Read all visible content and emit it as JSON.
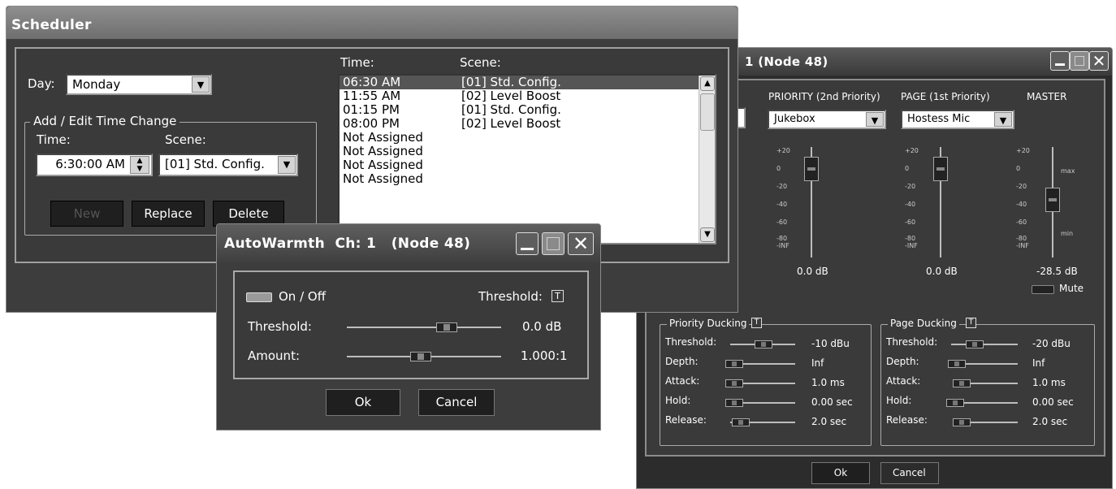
{
  "scheduler": {
    "title": "Scheduler",
    "day_label": "Day:",
    "day_value": "Monday",
    "group_label": "Add / Edit Time Change",
    "time_label": "Time:",
    "scene_label": "Scene:",
    "time_value": "6:30:00 AM",
    "scene_value": "[01] Std. Config.",
    "new_label": "New",
    "replace_label": "Replace",
    "delete_label": "Delete",
    "list_time_header": "Time:",
    "list_scene_header": "Scene:",
    "list": [
      {
        "time": "06:30 AM",
        "scene": "[01] Std. Config."
      },
      {
        "time": "11:55 AM",
        "scene": "[02] Level Boost"
      },
      {
        "time": "01:15 PM",
        "scene": "[01] Std. Config."
      },
      {
        "time": "08:00 PM",
        "scene": "[02] Level Boost"
      },
      {
        "time": "Not Assigned",
        "scene": ""
      },
      {
        "time": "Not Assigned",
        "scene": ""
      },
      {
        "time": "Not Assigned",
        "scene": ""
      },
      {
        "time": "Not Assigned",
        "scene": ""
      }
    ]
  },
  "autowarmth": {
    "title": "AutoWarmth  Ch: 1   (Node 48)",
    "on_off_label": "On / Off",
    "threshold_t_label": "Threshold:",
    "t_icon": "T",
    "threshold_label": "Threshold:",
    "threshold_value": "0.0 dB",
    "amount_label": "Amount:",
    "amount_value": "1.000:1",
    "ok_label": "Ok",
    "cancel_label": "Cancel"
  },
  "ducker": {
    "title": "1   (Node 48)",
    "priority_header": "PRIORITY (2nd Priority)",
    "priority_value": "Jukebox",
    "page_header": "PAGE (1st Priority)",
    "page_value": "Hostess Mic",
    "master_header": "MASTER",
    "fader_ticks": [
      "+20",
      "0",
      "-20",
      "-40",
      "-60",
      "-80",
      "-INF"
    ],
    "master_max": "max",
    "master_min": "min",
    "priority_db": "0.0 dB",
    "page_db": "0.0 dB",
    "master_db": "-28.5 dB",
    "mute_label": "Mute",
    "priority_ducking": {
      "label": "Priority Ducking",
      "t_icon": "T",
      "params": [
        {
          "name": "Threshold:",
          "value": "-10 dBu"
        },
        {
          "name": "Depth:",
          "value": "Inf"
        },
        {
          "name": "Attack:",
          "value": "1.0 ms"
        },
        {
          "name": "Hold:",
          "value": "0.00 sec"
        },
        {
          "name": "Release:",
          "value": "2.0 sec"
        }
      ]
    },
    "page_ducking": {
      "label": "Page Ducking",
      "t_icon": "T",
      "params": [
        {
          "name": "Threshold:",
          "value": "-20 dBu"
        },
        {
          "name": "Depth:",
          "value": "Inf"
        },
        {
          "name": "Attack:",
          "value": "1.0 ms"
        },
        {
          "name": "Hold:",
          "value": "0.00 sec"
        },
        {
          "name": "Release:",
          "value": "2.0 sec"
        }
      ]
    },
    "ok_label": "Ok",
    "cancel_label": "Cancel"
  }
}
